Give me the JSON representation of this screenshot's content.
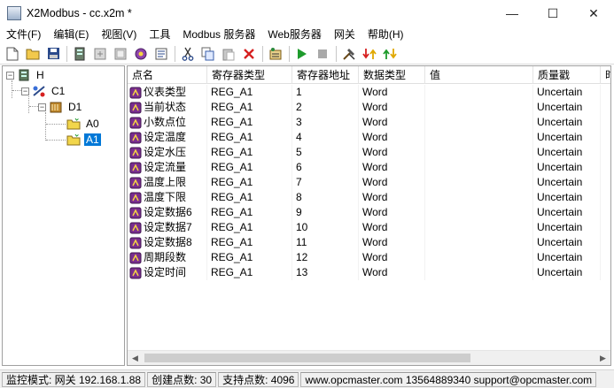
{
  "window": {
    "title": "X2Modbus - cc.x2m *",
    "minimize_glyph": "—",
    "maximize_glyph": "☐",
    "close_glyph": "✕",
    "app_icon_text": "MOD BUS"
  },
  "menu": [
    "文件(F)",
    "编辑(E)",
    "视图(V)",
    "工具",
    "Modbus 服务器",
    "Web服务器",
    "网关",
    "帮助(H)"
  ],
  "toolbar": {
    "buttons": [
      "new-file-icon",
      "open-folder-icon",
      "save-icon",
      "server-icon",
      "add-device-icon",
      "add-tag-group-icon",
      "add-tag-icon",
      "properties-icon",
      "cut-icon",
      "copy-icon",
      "paste-icon",
      "delete-icon",
      "monitor-icon",
      "run-icon",
      "stop-icon",
      "tools-icon",
      "import-icon",
      "export-icon"
    ]
  },
  "tree": {
    "root": "H",
    "channel": "C1",
    "device": "D1",
    "groups": [
      "A0",
      "A1"
    ],
    "selected": "A1"
  },
  "list": {
    "columns": [
      "点名",
      "寄存器类型",
      "寄存器地址",
      "数据类型",
      "值",
      "质量戳",
      "时"
    ],
    "rows": [
      {
        "name": "仪表类型",
        "reg_type": "REG_A1",
        "address": "1",
        "data_type": "Word",
        "value": "",
        "quality": "Uncertain"
      },
      {
        "name": "当前状态",
        "reg_type": "REG_A1",
        "address": "2",
        "data_type": "Word",
        "value": "",
        "quality": "Uncertain"
      },
      {
        "name": "小数点位",
        "reg_type": "REG_A1",
        "address": "3",
        "data_type": "Word",
        "value": "",
        "quality": "Uncertain"
      },
      {
        "name": "设定温度",
        "reg_type": "REG_A1",
        "address": "4",
        "data_type": "Word",
        "value": "",
        "quality": "Uncertain"
      },
      {
        "name": "设定水压",
        "reg_type": "REG_A1",
        "address": "5",
        "data_type": "Word",
        "value": "",
        "quality": "Uncertain"
      },
      {
        "name": "设定流量",
        "reg_type": "REG_A1",
        "address": "6",
        "data_type": "Word",
        "value": "",
        "quality": "Uncertain"
      },
      {
        "name": "温度上限",
        "reg_type": "REG_A1",
        "address": "7",
        "data_type": "Word",
        "value": "",
        "quality": "Uncertain"
      },
      {
        "name": "温度下限",
        "reg_type": "REG_A1",
        "address": "8",
        "data_type": "Word",
        "value": "",
        "quality": "Uncertain"
      },
      {
        "name": "设定数据6",
        "reg_type": "REG_A1",
        "address": "9",
        "data_type": "Word",
        "value": "",
        "quality": "Uncertain"
      },
      {
        "name": "设定数据7",
        "reg_type": "REG_A1",
        "address": "10",
        "data_type": "Word",
        "value": "",
        "quality": "Uncertain"
      },
      {
        "name": "设定数据8",
        "reg_type": "REG_A1",
        "address": "11",
        "data_type": "Word",
        "value": "",
        "quality": "Uncertain"
      },
      {
        "name": "周期段数",
        "reg_type": "REG_A1",
        "address": "12",
        "data_type": "Word",
        "value": "",
        "quality": "Uncertain"
      },
      {
        "name": "设定时间",
        "reg_type": "REG_A1",
        "address": "13",
        "data_type": "Word",
        "value": "",
        "quality": "Uncertain"
      }
    ],
    "scroll_left_glyph": "◀",
    "scroll_right_glyph": "▶"
  },
  "status": {
    "mode": "监控模式: 网关 192.168.1.88",
    "created": "创建点数: 30",
    "supported": "支持点数: 4096",
    "contact": "www.opcmaster.com 13564889340 support@opcmaster.com"
  },
  "colors": {
    "selection": "#0078d7",
    "tag_icon": "#7a2e8e",
    "folder": "#e6c200"
  }
}
